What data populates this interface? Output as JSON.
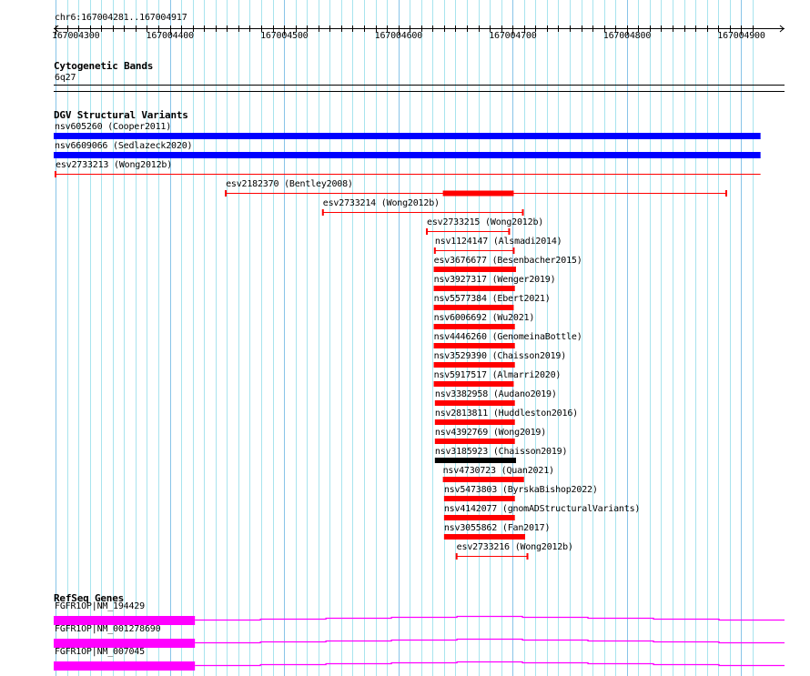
{
  "ruler": {
    "location": "chr6:167004281..167004917",
    "view_start": 167004281,
    "view_end": 167004917,
    "tick_labels": [
      "167004300",
      "167004400",
      "167004500",
      "167004600",
      "167004700",
      "167004800",
      "167004900"
    ]
  },
  "cytobands": {
    "title": "Cytogenetic Bands",
    "band": "6q27"
  },
  "dgv": {
    "title": "DGV Structural Variants",
    "colors": {
      "red": "#ff0000",
      "blue": "#0000ff",
      "black": "#000000"
    },
    "features": [
      {
        "label": "nsv605260 (Cooper2011)",
        "start": 167004281,
        "end": 167004917,
        "style": "thick",
        "color": "blue"
      },
      {
        "label": "nsv6609066 (Sedlazeck2020)",
        "start": 167004281,
        "end": 167004917,
        "style": "thick",
        "color": "blue"
      },
      {
        "label": "esv2733213 (Wong2012b)",
        "start": 167004300,
        "end": 167004917,
        "style": "thin",
        "color": "red"
      },
      {
        "label": "esv2182370 (Bentley2008)",
        "start": 167004449,
        "end": 167004887,
        "thick_start": 167004639,
        "thick_end": 167004701,
        "style": "thin-thick",
        "color": "red"
      },
      {
        "label": "esv2733214 (Wong2012b)",
        "start": 167004534,
        "end": 167004709,
        "style": "thin",
        "color": "red"
      },
      {
        "label": "esv2733215 (Wong2012b)",
        "start": 167004625,
        "end": 167004697,
        "style": "thin",
        "color": "red"
      },
      {
        "label": "nsv1124147 (Alsmadi2014)",
        "start": 167004632,
        "end": 167004701,
        "style": "thin",
        "color": "red"
      },
      {
        "label": "esv3676677 (Besenbacher2015)",
        "start": 167004631,
        "end": 167004703,
        "style": "thick",
        "color": "red"
      },
      {
        "label": "nsv3927317 (Wenger2019)",
        "start": 167004631,
        "end": 167004702,
        "style": "thick",
        "color": "red"
      },
      {
        "label": "nsv5577384 (Ebert2021)",
        "start": 167004631,
        "end": 167004701,
        "style": "thick",
        "color": "red"
      },
      {
        "label": "nsv6006692 (Wu2021)",
        "start": 167004631,
        "end": 167004702,
        "style": "thick",
        "color": "red"
      },
      {
        "label": "nsv4446260 (GenomeinaBottle)",
        "start": 167004631,
        "end": 167004702,
        "style": "thick",
        "color": "red"
      },
      {
        "label": "nsv3529390 (Chaisson2019)",
        "start": 167004631,
        "end": 167004702,
        "style": "thick",
        "color": "red"
      },
      {
        "label": "nsv5917517 (Almarri2020)",
        "start": 167004631,
        "end": 167004701,
        "style": "thick",
        "color": "red"
      },
      {
        "label": "nsv3382958 (Audano2019)",
        "start": 167004632,
        "end": 167004702,
        "style": "thick",
        "color": "red"
      },
      {
        "label": "nsv2813811 (Huddleston2016)",
        "start": 167004632,
        "end": 167004702,
        "style": "thick",
        "color": "red"
      },
      {
        "label": "nsv4392769 (Wong2019)",
        "start": 167004632,
        "end": 167004702,
        "style": "thick",
        "color": "red"
      },
      {
        "label": "nsv3185923 (Chaisson2019)",
        "start": 167004632,
        "end": 167004703,
        "style": "thick",
        "color": "black"
      },
      {
        "label": "nsv4730723 (Quan2021)",
        "start": 167004639,
        "end": 167004710,
        "style": "thick",
        "color": "red"
      },
      {
        "label": "nsv5473803 (ByrskaBishop2022)",
        "start": 167004640,
        "end": 167004702,
        "style": "thick",
        "color": "red"
      },
      {
        "label": "nsv4142077 (gnomADStructuralVariants)",
        "start": 167004640,
        "end": 167004702,
        "style": "thick",
        "color": "red"
      },
      {
        "label": "nsv3055862 (Fan2017)",
        "start": 167004640,
        "end": 167004711,
        "style": "thick",
        "color": "red"
      },
      {
        "label": "esv2733216 (Wong2012b)",
        "start": 167004651,
        "end": 167004713,
        "style": "thin",
        "color": "red"
      }
    ]
  },
  "refseq": {
    "title": "RefSeq Genes",
    "color": "#ff00ff",
    "genes": [
      {
        "label": "FGFR1OP|NM_194429",
        "exon_start": 167004281,
        "exon_end": 167004422
      },
      {
        "label": "FGFR1OP|NM_001278690",
        "exon_start": 167004281,
        "exon_end": 167004422
      },
      {
        "label": "FGFR1OP|NM_007045",
        "exon_start": 167004281,
        "exon_end": 167004422
      }
    ]
  }
}
